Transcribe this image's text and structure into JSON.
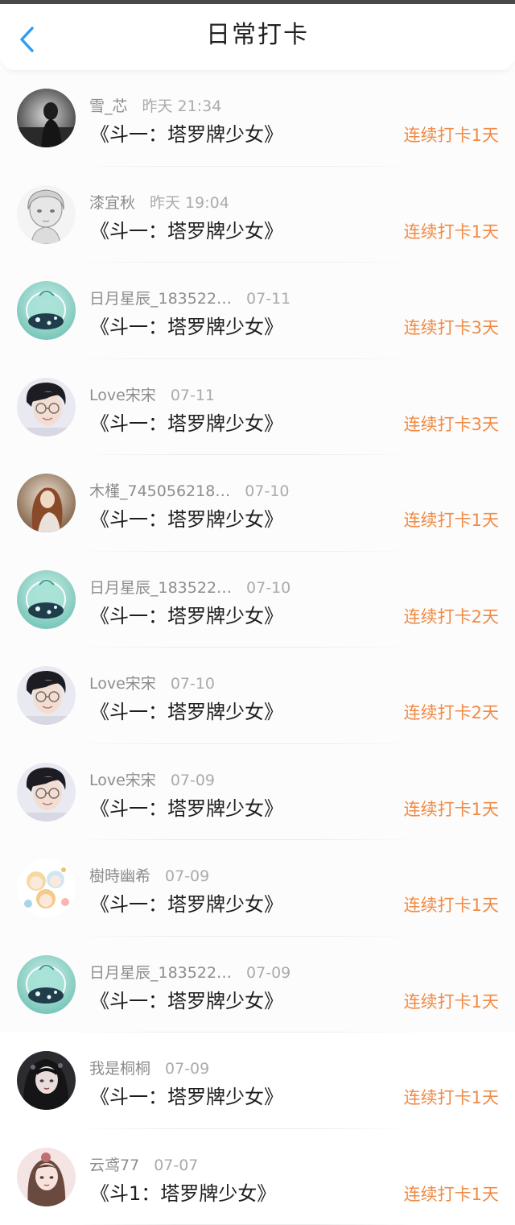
{
  "header": {
    "title": "日常打卡",
    "back_icon": "chevron-left-icon",
    "accent": "#2a9df4"
  },
  "colors": {
    "streak": "#f08a44",
    "name": "#8d8d8d",
    "book": "#1e1e1e"
  },
  "checkins": [
    {
      "name": "雪_芯",
      "time": "昨天 21:34",
      "book": "《斗一：塔罗牌少女》",
      "streak": "连续打卡1天",
      "avatar": "avatar-dark-girl"
    },
    {
      "name": "漆宜秋",
      "time": "昨天 19:04",
      "book": "《斗一：塔罗牌少女》",
      "streak": "连续打卡1天",
      "avatar": "avatar-sketch-girl"
    },
    {
      "name": "日月星辰_183522…",
      "time": "07-11",
      "book": "《斗一：塔罗牌少女》",
      "streak": "连续打卡3天",
      "avatar": "avatar-aqua-bowl"
    },
    {
      "name": "Love宋宋",
      "time": "07-11",
      "book": "《斗一：塔罗牌少女》",
      "streak": "连续打卡3天",
      "avatar": "avatar-boy-glasses"
    },
    {
      "name": "木槿_745056218…",
      "time": "07-10",
      "book": "《斗一：塔罗牌少女》",
      "streak": "连续打卡1天",
      "avatar": "avatar-brown-girl"
    },
    {
      "name": "日月星辰_183522…",
      "time": "07-10",
      "book": "《斗一：塔罗牌少女》",
      "streak": "连续打卡2天",
      "avatar": "avatar-aqua-bowl"
    },
    {
      "name": "Love宋宋",
      "time": "07-10",
      "book": "《斗一：塔罗牌少女》",
      "streak": "连续打卡2天",
      "avatar": "avatar-boy-glasses"
    },
    {
      "name": "Love宋宋",
      "time": "07-09",
      "book": "《斗一：塔罗牌少女》",
      "streak": "连续打卡1天",
      "avatar": "avatar-boy-glasses"
    },
    {
      "name": "樹時幽希",
      "time": "07-09",
      "book": "《斗一：塔罗牌少女》",
      "streak": "连续打卡1天",
      "avatar": "avatar-chibi"
    },
    {
      "name": "日月星辰_183522…",
      "time": "07-09",
      "book": "《斗一：塔罗牌少女》",
      "streak": "连续打卡1天",
      "avatar": "avatar-aqua-bowl"
    },
    {
      "name": "我是桐桐",
      "time": "07-09",
      "book": "《斗一：塔罗牌少女》",
      "streak": "连续打卡1天",
      "avatar": "avatar-gothic-girl"
    },
    {
      "name": "云鸢77",
      "time": "07-07",
      "book": "《斗1：塔罗牌少女》",
      "streak": "连续打卡1天",
      "avatar": "avatar-pink-girl"
    }
  ]
}
